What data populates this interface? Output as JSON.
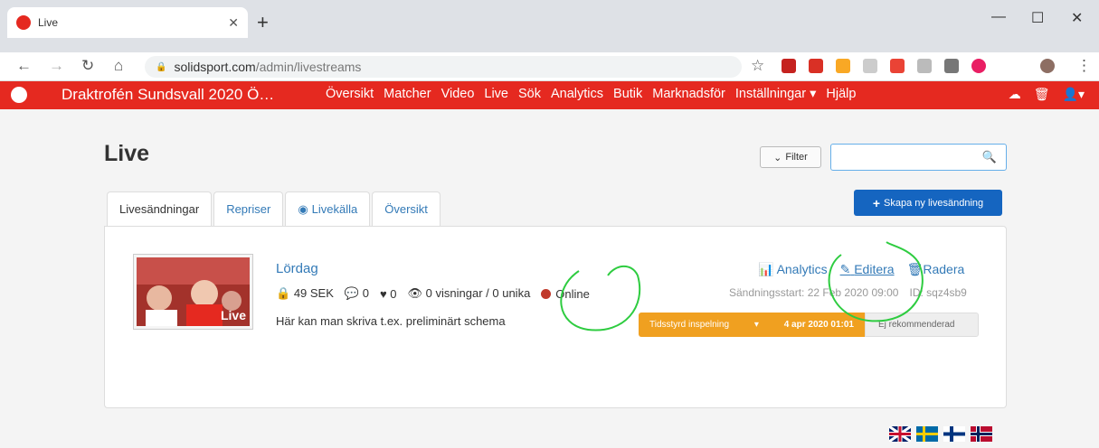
{
  "browser": {
    "tab_title": "Live",
    "url_host": "solidsport.com",
    "url_path": "/admin/livestreams"
  },
  "app_nav": {
    "brand": "Draktrofén Sundsvall 2020 Ö…",
    "menu": [
      "Översikt",
      "Matcher",
      "Video",
      "Live",
      "Sök",
      "Analytics",
      "Butik",
      "Marknadsför",
      "Inställningar ▾",
      "Hjälp"
    ]
  },
  "page": {
    "title": "Live",
    "filter_label": "Filter",
    "search_placeholder": "",
    "create_label": "Skapa ny livesändning",
    "tabs": [
      "Livesändningar",
      "Repriser",
      "Livekälla",
      "Översikt"
    ]
  },
  "stream": {
    "thumb_label": "Live",
    "title": "Lördag",
    "price": "49 SEK",
    "comments": "0",
    "likes": "0",
    "views": "0 visningar / 0 unika",
    "status": "Online",
    "description": "Här kan man skriva t.ex. preliminärt schema",
    "actions": [
      "Analytics",
      "Editera",
      "Radera"
    ],
    "start": "Sändningsstart: 22 Feb 2020 09:00",
    "id": "ID: sqz4sb9",
    "schedule_type": "Tidsstyrd inspelning",
    "schedule_date": "4 apr 2020 01:01",
    "recommend": "Ej rekommenderad"
  },
  "colors": {
    "brand": "#e52920",
    "link": "#337ab7",
    "primary": "#1565c0",
    "warning": "#f0a020"
  }
}
